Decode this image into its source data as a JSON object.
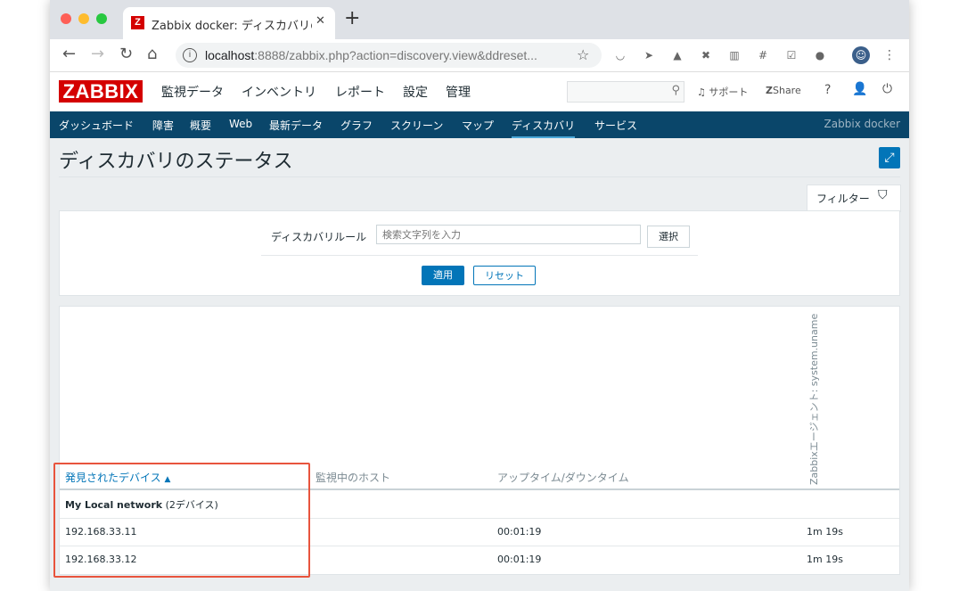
{
  "browser": {
    "tab_title": "Zabbix docker: ディスカバリのス",
    "tab_logo": "Z",
    "url_host": "localhost",
    "url_rest": ":8888/zabbix.php?action=discovery.view&ddreset..."
  },
  "header": {
    "logo": "ZABBIX",
    "menu": [
      "監視データ",
      "インベントリ",
      "レポート",
      "設定",
      "管理"
    ],
    "support": "サポート",
    "share": "Share",
    "help": "?"
  },
  "subnav": {
    "items": [
      "ダッシュボード",
      "障害",
      "概要",
      "Web",
      "最新データ",
      "グラフ",
      "スクリーン",
      "マップ",
      "ディスカバリ",
      "サービス"
    ],
    "active": "ディスカバリ",
    "server_name": "Zabbix docker"
  },
  "page": {
    "title": "ディスカバリのステータス"
  },
  "filter": {
    "tab_label": "フィルター",
    "rule_label": "ディスカバリルール",
    "rule_placeholder": "検索文字列を入力",
    "select_button": "選択",
    "apply_button": "適用",
    "reset_button": "リセット"
  },
  "table": {
    "columns": {
      "device": "発見されたデバイス",
      "monitored_host": "監視中のホスト",
      "uptime": "アップタイム/ダウンタイム",
      "check": "Zabbixエージェント: system.uname"
    },
    "group": {
      "name": "My Local network",
      "count": "(2デバイス)"
    },
    "rows": [
      {
        "device": "192.168.33.11",
        "host": "",
        "uptime": "00:01:19",
        "check": "1m 19s"
      },
      {
        "device": "192.168.33.12",
        "host": "",
        "uptime": "00:01:19",
        "check": "1m 19s"
      }
    ]
  },
  "colors": {
    "zabbix_red": "#d40000",
    "nav_blue": "#0a466a",
    "accent_blue": "#0275b8",
    "highlight_red": "#e8543d"
  }
}
